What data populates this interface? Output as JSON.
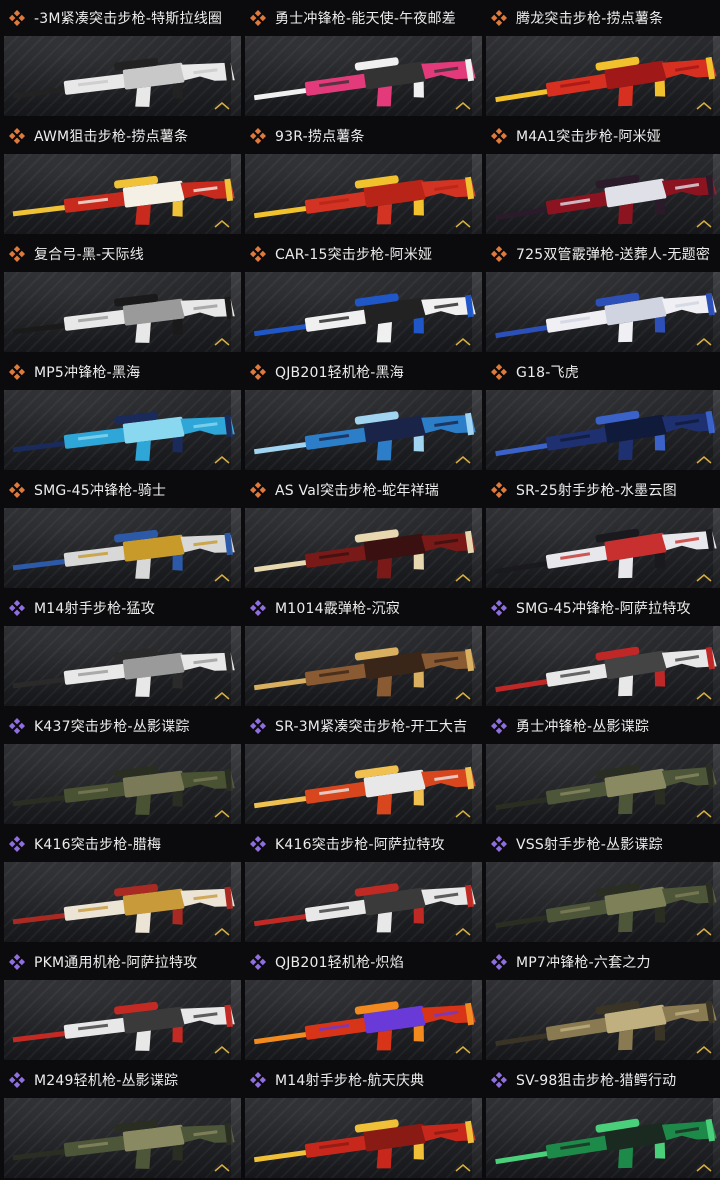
{
  "colors": {
    "legendary": "#e07a3c",
    "epic": "#8f6ee0",
    "background": "#0b0b0d",
    "text": "#ececec"
  },
  "icons": {
    "legendary": "orange-diamond-cluster-icon",
    "epic": "purple-diamond-cluster-icon"
  },
  "skins": [
    {
      "name": "-3M紧凑突击步枪-特斯拉线圈",
      "rarity": "legendary",
      "palette": [
        "#e8e8e8",
        "#222222",
        "#c8c8c8"
      ]
    },
    {
      "name": "勇士冲锋枪-能天使-午夜邮差",
      "rarity": "legendary",
      "palette": [
        "#e23a7a",
        "#f0f0f0",
        "#333333"
      ]
    },
    {
      "name": "腾龙突击步枪-捞点薯条",
      "rarity": "legendary",
      "palette": [
        "#d83020",
        "#f2c12e",
        "#a01818"
      ]
    },
    {
      "name": "AWM狙击步枪-捞点薯条",
      "rarity": "legendary",
      "palette": [
        "#c82a1e",
        "#f0c238",
        "#f4f0e6"
      ]
    },
    {
      "name": "93R-捞点薯条",
      "rarity": "legendary",
      "palette": [
        "#d23322",
        "#f2c12e",
        "#b82418"
      ]
    },
    {
      "name": "M4A1突击步枪-阿米娅",
      "rarity": "legendary",
      "palette": [
        "#8c1420",
        "#2a1a2a",
        "#e0e0e8"
      ]
    },
    {
      "name": "复合弓-黑-天际线",
      "rarity": "legendary",
      "palette": [
        "#e8e8e8",
        "#1a1a1a",
        "#9a9a9a"
      ]
    },
    {
      "name": "CAR-15突击步枪-阿米娅",
      "rarity": "legendary",
      "palette": [
        "#f0f0f0",
        "#1f56c8",
        "#222222"
      ]
    },
    {
      "name": "725双管霰弹枪-送葬人-无题密",
      "rarity": "legendary",
      "palette": [
        "#f0f0f4",
        "#2c50b8",
        "#d0d4e0"
      ]
    },
    {
      "name": "MP5冲锋枪-黑海",
      "rarity": "legendary",
      "palette": [
        "#2fa6d8",
        "#1a2a5a",
        "#8ad8f0"
      ]
    },
    {
      "name": "QJB201轻机枪-黑海",
      "rarity": "legendary",
      "palette": [
        "#2c7ec8",
        "#a0d4f0",
        "#1a2448"
      ]
    },
    {
      "name": "G18-飞虎",
      "rarity": "legendary",
      "palette": [
        "#1e3070",
        "#3a62c8",
        "#101a3a"
      ]
    },
    {
      "name": "SMG-45冲锋枪-骑士",
      "rarity": "legendary",
      "palette": [
        "#d8d8d8",
        "#2c5aa8",
        "#c89a2a"
      ]
    },
    {
      "name": "AS Val突击步枪-蛇年祥瑞",
      "rarity": "legendary",
      "palette": [
        "#7a1a18",
        "#e8d8b0",
        "#3a1010"
      ]
    },
    {
      "name": "SR-25射手步枪-水墨云图",
      "rarity": "legendary",
      "palette": [
        "#e8e8ec",
        "#1a1a1e",
        "#c83030"
      ]
    },
    {
      "name": "M14射手步枪-猛攻",
      "rarity": "epic",
      "palette": [
        "#e8e8e8",
        "#2a2a2a",
        "#9a9a9a"
      ]
    },
    {
      "name": "M1014霰弹枪-沉寂",
      "rarity": "epic",
      "palette": [
        "#8a5a32",
        "#d8b060",
        "#3a2618"
      ]
    },
    {
      "name": "SMG-45冲锋枪-阿萨拉特攻",
      "rarity": "epic",
      "palette": [
        "#e8e8e8",
        "#c02828",
        "#444444"
      ]
    },
    {
      "name": "K437突击步枪-丛影谍踪",
      "rarity": "epic",
      "palette": [
        "#4a5234",
        "#2a2e22",
        "#7a7a58"
      ]
    },
    {
      "name": "SR-3M紧凑突击步枪-开工大吉",
      "rarity": "epic",
      "palette": [
        "#d8461e",
        "#f0c050",
        "#e8e8e8"
      ]
    },
    {
      "name": "勇士冲锋枪-丛影谍踪",
      "rarity": "epic",
      "palette": [
        "#4e563a",
        "#2a2e22",
        "#8a8a62"
      ]
    },
    {
      "name": "K416突击步枪-腊梅",
      "rarity": "epic",
      "palette": [
        "#ece4d4",
        "#a82a22",
        "#c89a3a"
      ]
    },
    {
      "name": "K416突击步枪-阿萨拉特攻",
      "rarity": "epic",
      "palette": [
        "#e8e8e8",
        "#c02a24",
        "#3a3a3a"
      ]
    },
    {
      "name": "VSS射手步枪-丛影谍踪",
      "rarity": "epic",
      "palette": [
        "#4e563a",
        "#2a2e22",
        "#7e8058"
      ]
    },
    {
      "name": "PKM通用机枪-阿萨拉特攻",
      "rarity": "epic",
      "palette": [
        "#e8e8e8",
        "#c42a24",
        "#3a3a3a"
      ]
    },
    {
      "name": "QJB201轻机枪-炽焰",
      "rarity": "epic",
      "palette": [
        "#d83418",
        "#f28a20",
        "#6a3ad8"
      ]
    },
    {
      "name": "MP7冲锋枪-六套之力",
      "rarity": "epic",
      "palette": [
        "#8a7a52",
        "#3a3426",
        "#c0b080"
      ]
    },
    {
      "name": "M249轻机枪-丛影谍踪",
      "rarity": "epic",
      "palette": [
        "#4e563a",
        "#2a2e22",
        "#8a8a62"
      ]
    },
    {
      "name": "M14射手步枪-航天庆典",
      "rarity": "epic",
      "palette": [
        "#c8281c",
        "#f0c038",
        "#8a1a14"
      ]
    },
    {
      "name": "SV-98狙击步枪-猎鳄行动",
      "rarity": "epic",
      "palette": [
        "#1e8a4a",
        "#4ad07a",
        "#1a2a20"
      ]
    }
  ]
}
